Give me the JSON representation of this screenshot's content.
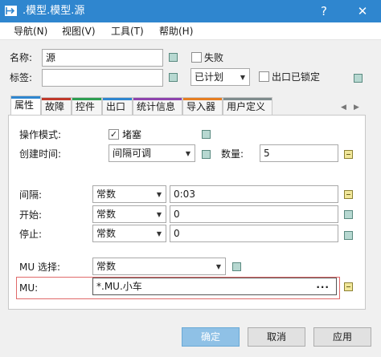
{
  "window": {
    "title": ".模型.模型.源",
    "help_glyph": "?",
    "close_glyph": "✕"
  },
  "menu": [
    "导航(N)",
    "视图(V)",
    "工具(T)",
    "帮助(H)"
  ],
  "header": {
    "name_label": "名称:",
    "name_value": "源",
    "failed_label": "失败",
    "tag_label": "标签:",
    "tag_value": "",
    "plan_value": "已计划",
    "exit_locked_label": "出口已锁定"
  },
  "tabs": [
    {
      "label": "属性",
      "color": "#2f86cf",
      "active": true
    },
    {
      "label": "故障",
      "color": "#c0392b"
    },
    {
      "label": "控件",
      "color": "#2e9e52"
    },
    {
      "label": "出口",
      "color": "#2f86cf"
    },
    {
      "label": "统计信息",
      "color": "#8e44ad"
    },
    {
      "label": "导入器",
      "color": "#e67e22"
    },
    {
      "label": "用户定义",
      "color": "#7f8c8d"
    }
  ],
  "tab_nav": {
    "left": "◀",
    "right": "▶"
  },
  "properties": {
    "operation_mode_label": "操作模式:",
    "blocked_label": "堵塞",
    "blocked_checked": true,
    "check_glyph": "✓",
    "creation_time_label": "创建时间:",
    "creation_time_value": "间隔可调",
    "quantity_label": "数量:",
    "quantity_value": "5",
    "interval_label": "间隔:",
    "interval_type": "常数",
    "interval_value": "0:03",
    "start_label": "开始:",
    "start_type": "常数",
    "start_value": "0",
    "stop_label": "停止:",
    "stop_type": "常数",
    "stop_value": "0",
    "mu_selection_label": "MU 选择:",
    "mu_selection_value": "常数",
    "mu_label": "MU:",
    "mu_value": "*.MU.小车",
    "browse_label": "..."
  },
  "buttons": {
    "ok": "确定",
    "cancel": "取消",
    "apply": "应用"
  },
  "colors": {
    "titlebar": "#2f86cf",
    "primary_button": "#8fc1e6",
    "highlight_border": "#e06a6a"
  }
}
